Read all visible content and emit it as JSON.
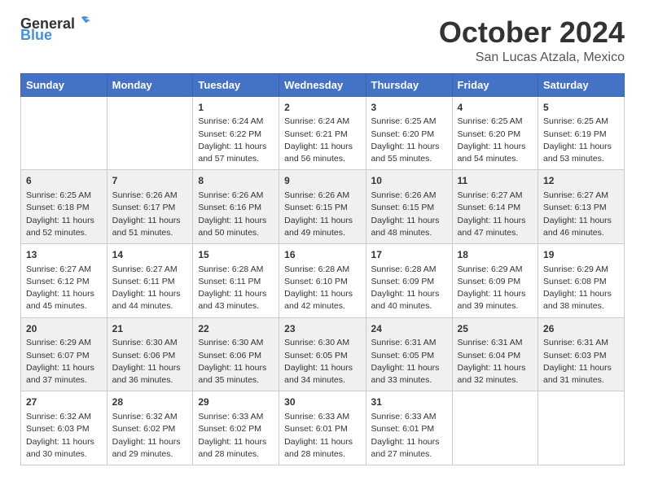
{
  "header": {
    "logo_general": "General",
    "logo_blue": "Blue",
    "month": "October 2024",
    "location": "San Lucas Atzala, Mexico"
  },
  "weekdays": [
    "Sunday",
    "Monday",
    "Tuesday",
    "Wednesday",
    "Thursday",
    "Friday",
    "Saturday"
  ],
  "weeks": [
    [
      null,
      null,
      {
        "day": "1",
        "sunrise": "6:24 AM",
        "sunset": "6:22 PM",
        "daylight": "11 hours and 57 minutes."
      },
      {
        "day": "2",
        "sunrise": "6:24 AM",
        "sunset": "6:21 PM",
        "daylight": "11 hours and 56 minutes."
      },
      {
        "day": "3",
        "sunrise": "6:25 AM",
        "sunset": "6:20 PM",
        "daylight": "11 hours and 55 minutes."
      },
      {
        "day": "4",
        "sunrise": "6:25 AM",
        "sunset": "6:20 PM",
        "daylight": "11 hours and 54 minutes."
      },
      {
        "day": "5",
        "sunrise": "6:25 AM",
        "sunset": "6:19 PM",
        "daylight": "11 hours and 53 minutes."
      }
    ],
    [
      {
        "day": "6",
        "sunrise": "6:25 AM",
        "sunset": "6:18 PM",
        "daylight": "11 hours and 52 minutes."
      },
      {
        "day": "7",
        "sunrise": "6:26 AM",
        "sunset": "6:17 PM",
        "daylight": "11 hours and 51 minutes."
      },
      {
        "day": "8",
        "sunrise": "6:26 AM",
        "sunset": "6:16 PM",
        "daylight": "11 hours and 50 minutes."
      },
      {
        "day": "9",
        "sunrise": "6:26 AM",
        "sunset": "6:15 PM",
        "daylight": "11 hours and 49 minutes."
      },
      {
        "day": "10",
        "sunrise": "6:26 AM",
        "sunset": "6:15 PM",
        "daylight": "11 hours and 48 minutes."
      },
      {
        "day": "11",
        "sunrise": "6:27 AM",
        "sunset": "6:14 PM",
        "daylight": "11 hours and 47 minutes."
      },
      {
        "day": "12",
        "sunrise": "6:27 AM",
        "sunset": "6:13 PM",
        "daylight": "11 hours and 46 minutes."
      }
    ],
    [
      {
        "day": "13",
        "sunrise": "6:27 AM",
        "sunset": "6:12 PM",
        "daylight": "11 hours and 45 minutes."
      },
      {
        "day": "14",
        "sunrise": "6:27 AM",
        "sunset": "6:11 PM",
        "daylight": "11 hours and 44 minutes."
      },
      {
        "day": "15",
        "sunrise": "6:28 AM",
        "sunset": "6:11 PM",
        "daylight": "11 hours and 43 minutes."
      },
      {
        "day": "16",
        "sunrise": "6:28 AM",
        "sunset": "6:10 PM",
        "daylight": "11 hours and 42 minutes."
      },
      {
        "day": "17",
        "sunrise": "6:28 AM",
        "sunset": "6:09 PM",
        "daylight": "11 hours and 40 minutes."
      },
      {
        "day": "18",
        "sunrise": "6:29 AM",
        "sunset": "6:09 PM",
        "daylight": "11 hours and 39 minutes."
      },
      {
        "day": "19",
        "sunrise": "6:29 AM",
        "sunset": "6:08 PM",
        "daylight": "11 hours and 38 minutes."
      }
    ],
    [
      {
        "day": "20",
        "sunrise": "6:29 AM",
        "sunset": "6:07 PM",
        "daylight": "11 hours and 37 minutes."
      },
      {
        "day": "21",
        "sunrise": "6:30 AM",
        "sunset": "6:06 PM",
        "daylight": "11 hours and 36 minutes."
      },
      {
        "day": "22",
        "sunrise": "6:30 AM",
        "sunset": "6:06 PM",
        "daylight": "11 hours and 35 minutes."
      },
      {
        "day": "23",
        "sunrise": "6:30 AM",
        "sunset": "6:05 PM",
        "daylight": "11 hours and 34 minutes."
      },
      {
        "day": "24",
        "sunrise": "6:31 AM",
        "sunset": "6:05 PM",
        "daylight": "11 hours and 33 minutes."
      },
      {
        "day": "25",
        "sunrise": "6:31 AM",
        "sunset": "6:04 PM",
        "daylight": "11 hours and 32 minutes."
      },
      {
        "day": "26",
        "sunrise": "6:31 AM",
        "sunset": "6:03 PM",
        "daylight": "11 hours and 31 minutes."
      }
    ],
    [
      {
        "day": "27",
        "sunrise": "6:32 AM",
        "sunset": "6:03 PM",
        "daylight": "11 hours and 30 minutes."
      },
      {
        "day": "28",
        "sunrise": "6:32 AM",
        "sunset": "6:02 PM",
        "daylight": "11 hours and 29 minutes."
      },
      {
        "day": "29",
        "sunrise": "6:33 AM",
        "sunset": "6:02 PM",
        "daylight": "11 hours and 28 minutes."
      },
      {
        "day": "30",
        "sunrise": "6:33 AM",
        "sunset": "6:01 PM",
        "daylight": "11 hours and 28 minutes."
      },
      {
        "day": "31",
        "sunrise": "6:33 AM",
        "sunset": "6:01 PM",
        "daylight": "11 hours and 27 minutes."
      },
      null,
      null
    ]
  ],
  "labels": {
    "sunrise_prefix": "Sunrise: ",
    "sunset_prefix": "Sunset: ",
    "daylight_prefix": "Daylight: "
  }
}
